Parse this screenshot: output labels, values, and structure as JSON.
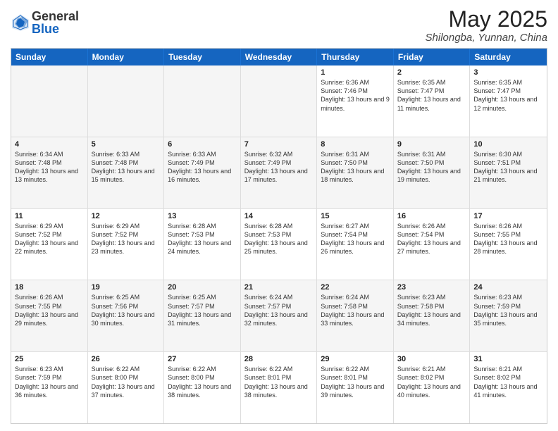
{
  "logo": {
    "general": "General",
    "blue": "Blue"
  },
  "header": {
    "month": "May 2025",
    "location": "Shilongba, Yunnan, China"
  },
  "weekdays": [
    "Sunday",
    "Monday",
    "Tuesday",
    "Wednesday",
    "Thursday",
    "Friday",
    "Saturday"
  ],
  "rows": [
    [
      {
        "day": "",
        "text": "",
        "empty": true
      },
      {
        "day": "",
        "text": "",
        "empty": true
      },
      {
        "day": "",
        "text": "",
        "empty": true
      },
      {
        "day": "",
        "text": "",
        "empty": true
      },
      {
        "day": "1",
        "text": "Sunrise: 6:36 AM\nSunset: 7:46 PM\nDaylight: 13 hours and 9 minutes.",
        "empty": false
      },
      {
        "day": "2",
        "text": "Sunrise: 6:35 AM\nSunset: 7:47 PM\nDaylight: 13 hours and 11 minutes.",
        "empty": false
      },
      {
        "day": "3",
        "text": "Sunrise: 6:35 AM\nSunset: 7:47 PM\nDaylight: 13 hours and 12 minutes.",
        "empty": false
      }
    ],
    [
      {
        "day": "4",
        "text": "Sunrise: 6:34 AM\nSunset: 7:48 PM\nDaylight: 13 hours and 13 minutes.",
        "empty": false
      },
      {
        "day": "5",
        "text": "Sunrise: 6:33 AM\nSunset: 7:48 PM\nDaylight: 13 hours and 15 minutes.",
        "empty": false
      },
      {
        "day": "6",
        "text": "Sunrise: 6:33 AM\nSunset: 7:49 PM\nDaylight: 13 hours and 16 minutes.",
        "empty": false
      },
      {
        "day": "7",
        "text": "Sunrise: 6:32 AM\nSunset: 7:49 PM\nDaylight: 13 hours and 17 minutes.",
        "empty": false
      },
      {
        "day": "8",
        "text": "Sunrise: 6:31 AM\nSunset: 7:50 PM\nDaylight: 13 hours and 18 minutes.",
        "empty": false
      },
      {
        "day": "9",
        "text": "Sunrise: 6:31 AM\nSunset: 7:50 PM\nDaylight: 13 hours and 19 minutes.",
        "empty": false
      },
      {
        "day": "10",
        "text": "Sunrise: 6:30 AM\nSunset: 7:51 PM\nDaylight: 13 hours and 21 minutes.",
        "empty": false
      }
    ],
    [
      {
        "day": "11",
        "text": "Sunrise: 6:29 AM\nSunset: 7:52 PM\nDaylight: 13 hours and 22 minutes.",
        "empty": false
      },
      {
        "day": "12",
        "text": "Sunrise: 6:29 AM\nSunset: 7:52 PM\nDaylight: 13 hours and 23 minutes.",
        "empty": false
      },
      {
        "day": "13",
        "text": "Sunrise: 6:28 AM\nSunset: 7:53 PM\nDaylight: 13 hours and 24 minutes.",
        "empty": false
      },
      {
        "day": "14",
        "text": "Sunrise: 6:28 AM\nSunset: 7:53 PM\nDaylight: 13 hours and 25 minutes.",
        "empty": false
      },
      {
        "day": "15",
        "text": "Sunrise: 6:27 AM\nSunset: 7:54 PM\nDaylight: 13 hours and 26 minutes.",
        "empty": false
      },
      {
        "day": "16",
        "text": "Sunrise: 6:26 AM\nSunset: 7:54 PM\nDaylight: 13 hours and 27 minutes.",
        "empty": false
      },
      {
        "day": "17",
        "text": "Sunrise: 6:26 AM\nSunset: 7:55 PM\nDaylight: 13 hours and 28 minutes.",
        "empty": false
      }
    ],
    [
      {
        "day": "18",
        "text": "Sunrise: 6:26 AM\nSunset: 7:55 PM\nDaylight: 13 hours and 29 minutes.",
        "empty": false
      },
      {
        "day": "19",
        "text": "Sunrise: 6:25 AM\nSunset: 7:56 PM\nDaylight: 13 hours and 30 minutes.",
        "empty": false
      },
      {
        "day": "20",
        "text": "Sunrise: 6:25 AM\nSunset: 7:57 PM\nDaylight: 13 hours and 31 minutes.",
        "empty": false
      },
      {
        "day": "21",
        "text": "Sunrise: 6:24 AM\nSunset: 7:57 PM\nDaylight: 13 hours and 32 minutes.",
        "empty": false
      },
      {
        "day": "22",
        "text": "Sunrise: 6:24 AM\nSunset: 7:58 PM\nDaylight: 13 hours and 33 minutes.",
        "empty": false
      },
      {
        "day": "23",
        "text": "Sunrise: 6:23 AM\nSunset: 7:58 PM\nDaylight: 13 hours and 34 minutes.",
        "empty": false
      },
      {
        "day": "24",
        "text": "Sunrise: 6:23 AM\nSunset: 7:59 PM\nDaylight: 13 hours and 35 minutes.",
        "empty": false
      }
    ],
    [
      {
        "day": "25",
        "text": "Sunrise: 6:23 AM\nSunset: 7:59 PM\nDaylight: 13 hours and 36 minutes.",
        "empty": false
      },
      {
        "day": "26",
        "text": "Sunrise: 6:22 AM\nSunset: 8:00 PM\nDaylight: 13 hours and 37 minutes.",
        "empty": false
      },
      {
        "day": "27",
        "text": "Sunrise: 6:22 AM\nSunset: 8:00 PM\nDaylight: 13 hours and 38 minutes.",
        "empty": false
      },
      {
        "day": "28",
        "text": "Sunrise: 6:22 AM\nSunset: 8:01 PM\nDaylight: 13 hours and 38 minutes.",
        "empty": false
      },
      {
        "day": "29",
        "text": "Sunrise: 6:22 AM\nSunset: 8:01 PM\nDaylight: 13 hours and 39 minutes.",
        "empty": false
      },
      {
        "day": "30",
        "text": "Sunrise: 6:21 AM\nSunset: 8:02 PM\nDaylight: 13 hours and 40 minutes.",
        "empty": false
      },
      {
        "day": "31",
        "text": "Sunrise: 6:21 AM\nSunset: 8:02 PM\nDaylight: 13 hours and 41 minutes.",
        "empty": false
      }
    ]
  ]
}
